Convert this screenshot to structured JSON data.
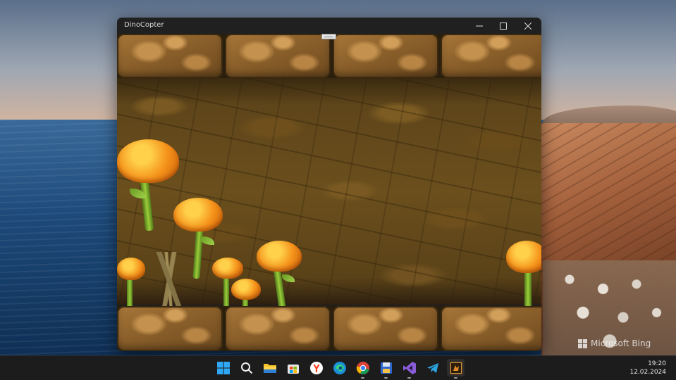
{
  "window": {
    "title": "DinoCopter",
    "minimize_icon": "minimize-icon",
    "maximize_icon": "maximize-icon",
    "close_icon": "close-icon"
  },
  "wallpaper": {
    "watermark": "Microsoft Bing"
  },
  "taskbar": {
    "apps": [
      {
        "name": "start",
        "icon": "windows-start-icon",
        "running": false
      },
      {
        "name": "search",
        "icon": "search-icon",
        "running": false
      },
      {
        "name": "file-explorer",
        "icon": "folder-icon",
        "running": false
      },
      {
        "name": "microsoft-store",
        "icon": "store-icon",
        "running": false
      },
      {
        "name": "yandex-browser",
        "icon": "yandex-icon",
        "running": false
      },
      {
        "name": "edge",
        "icon": "edge-icon",
        "running": false
      },
      {
        "name": "chrome",
        "icon": "chrome-icon",
        "running": true
      },
      {
        "name": "save-app",
        "icon": "floppy-disk-icon",
        "running": true
      },
      {
        "name": "visual-studio",
        "icon": "visual-studio-icon",
        "running": true
      },
      {
        "name": "telegram",
        "icon": "telegram-icon",
        "running": false
      },
      {
        "name": "dinocopter",
        "icon": "dinocopter-app-icon",
        "running": true
      }
    ],
    "clock": {
      "time": "19:20",
      "date": "12.02.2024"
    }
  },
  "colors": {
    "taskbar_bg": "#1c1c1c",
    "titlebar_bg": "#202020",
    "mushroom_cap": "#f5921a",
    "cave_rock": "#6b4f1d"
  }
}
